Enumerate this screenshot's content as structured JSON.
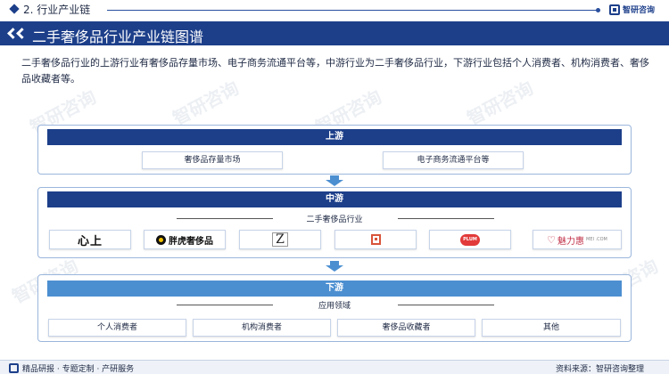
{
  "header": {
    "section_title": "2. 行业产业链",
    "brand_name": "智研咨询"
  },
  "banner": {
    "title": "二手奢侈品行业产业链图谱"
  },
  "intro": {
    "text": "二手奢侈品行业的上游行业有奢侈品存量市场、电子商务流通平台等，中游行业为二手奢侈品行业，下游行业包括个人消费者、机构消费者、奢侈品收藏者等。"
  },
  "upstream": {
    "title": "上游",
    "items": [
      "奢侈品存量市场",
      "电子商务流通平台等"
    ]
  },
  "midstream": {
    "title": "中游",
    "subtitle": "二手奢侈品行业",
    "logos": [
      {
        "name": "xinshang",
        "text": "心上"
      },
      {
        "name": "feihu",
        "text": "胖虎奢侈品"
      },
      {
        "name": "z-logo",
        "text": "Z"
      },
      {
        "name": "square-logo",
        "text": ""
      },
      {
        "name": "plum",
        "text": "PLUM"
      },
      {
        "name": "meilihui",
        "text": "魅力惠",
        "sub": "MEI .COM"
      }
    ]
  },
  "downstream": {
    "title": "下游",
    "subtitle": "应用领域",
    "items": [
      "个人消费者",
      "机构消费者",
      "奢侈品收藏者",
      "其他"
    ]
  },
  "footer": {
    "left_text": "精品研报 · 专题定制 · 产研服务",
    "right_text": "资料来源：智研咨询整理"
  },
  "watermark": {
    "text": "智研咨询"
  },
  "colors": {
    "primary": "#1d3f8a",
    "secondary": "#4c8fd1",
    "border": "#9bb6dc"
  }
}
